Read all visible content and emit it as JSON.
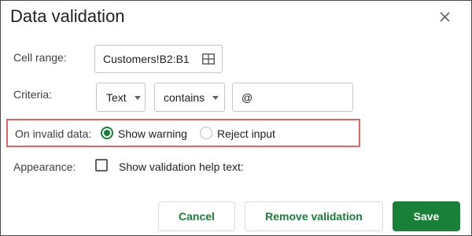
{
  "dialog": {
    "title": "Data validation",
    "close_icon": "close-icon"
  },
  "cell_range": {
    "label": "Cell range:",
    "value": "Customers!B2:B1",
    "icon": "grid-select-icon"
  },
  "criteria": {
    "label": "Criteria:",
    "type_value": "Text",
    "operator_value": "contains",
    "input_value": "@"
  },
  "invalid_data": {
    "label": "On invalid data:",
    "options": [
      {
        "label": "Show warning",
        "selected": true
      },
      {
        "label": "Reject input",
        "selected": false
      }
    ],
    "highlight_color": "#e06666"
  },
  "appearance": {
    "label": "Appearance:",
    "checkbox_label": "Show validation help text:",
    "checked": false
  },
  "buttons": {
    "cancel": "Cancel",
    "remove": "Remove validation",
    "save": "Save"
  },
  "colors": {
    "accent": "#188038"
  }
}
